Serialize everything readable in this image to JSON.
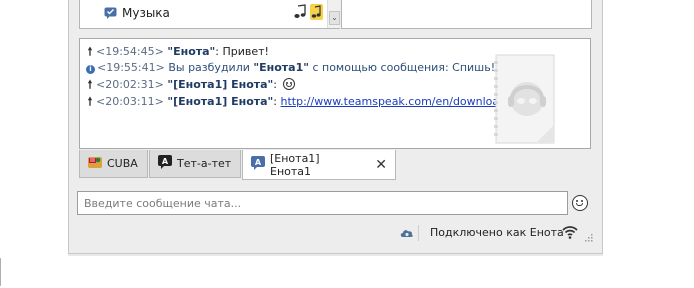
{
  "tree": {
    "channel_label": "Музыка"
  },
  "chat": {
    "lines": [
      {
        "ts": "<19:54:45>",
        "nick": "\"Енота\"",
        "text": ": Привет!"
      },
      {
        "ts": "<19:55:41>",
        "pre": "Вы разбудили ",
        "nick": "\"Енота1\"",
        "text": " с помощью сообщения: Спишь!"
      },
      {
        "ts": "<20:02:31>",
        "nick": "\"[Енота1] Енота\"",
        "text": ": "
      },
      {
        "ts": "<20:03:11>",
        "nick": "\"[Енота1] Енота\"",
        "text": ": ",
        "link": "http://www.teamspeak.com/en/downloads"
      }
    ]
  },
  "tabs": [
    {
      "label": "CUBA",
      "icon": "server-flag-icon",
      "active": false
    },
    {
      "label": "Тет-а-тет",
      "icon": "private-chat-icon",
      "active": false
    },
    {
      "label": "[Енота1] Енота1",
      "icon": "user-chat-icon",
      "active": true
    }
  ],
  "input": {
    "placeholder": "Введите сообщение чата..."
  },
  "status": {
    "connection_text": "Подключено как Енота"
  },
  "colors": {
    "timestamp": "#5a6d86",
    "nickname": "#1f3a63",
    "link": "#1a3dbf",
    "window_bg": "#ededed"
  }
}
